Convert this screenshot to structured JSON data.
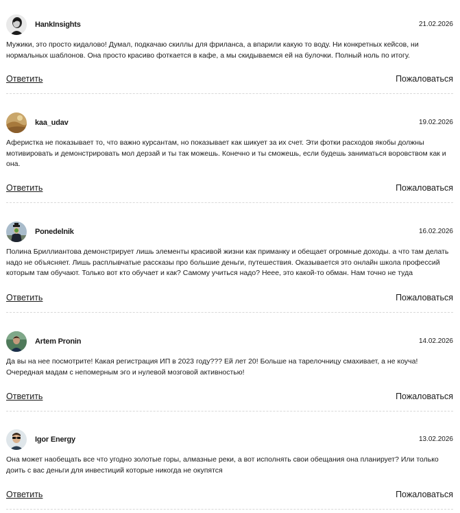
{
  "comments": [
    {
      "author": "HankInsights",
      "date": "21.02.2026",
      "avatar_icon": "man-avatar-icon",
      "text": "Мужики, это просто кидалово! Думал, подкачаю скиллы для фриланса, а впарили какую то воду. Ни конкретных кейсов, ни нормальных шаблонов. Она просто красиво фоткается в кафе, а мы скидываемся ей на булочки. Полный ноль по итогу.",
      "reply_label": "Ответить",
      "report_label": "Пожаловаться"
    },
    {
      "author": "kaa_udav",
      "date": "19.02.2026",
      "avatar_icon": "desert-avatar-icon",
      "text": "Аферистка не показывает то, что важно курсантам, но показывает как шикует за их счет. Эти фотки расходов якобы должны мотивировать и демонстрировать мол дерзай и ты так можешь. Конечно и ты сможешь, если будешь заниматься воровством как и она.",
      "reply_label": "Ответить",
      "report_label": "Пожаловаться"
    },
    {
      "author": "Ponedelnik",
      "date": "16.02.2026",
      "avatar_icon": "apple-man-avatar-icon",
      "text": "Полина Бриллиантова демонстрирует лишь элементы красивой жизни как приманку и обещает огромные доходы. а что там делать надо не объясняет. Лишь расплывчатые рассказы про большие деньги, путешествия. Оказывается это онлайн школа профессий которым там обучают. Только вот кто обучает и как? Самому учиться надо? Нееe, это какой-то обман. Нам точно не туда",
      "reply_label": "Ответить",
      "report_label": "Пожаловаться"
    },
    {
      "author": "Artem Pronin",
      "date": "14.02.2026",
      "avatar_icon": "person-avatar-icon",
      "text": "Да вы на нее посмотрите! Какая регистрация ИП в 2023 году??? Ей лет 20! Больше на тарелочницу смахивает, а не коуча! Очередная мадам с непомерным эго и нулевой мозговой активностью!",
      "reply_label": "Ответить",
      "report_label": "Пожаловаться"
    },
    {
      "author": "Igor Energy",
      "date": "13.02.2026",
      "avatar_icon": "sunglasses-avatar-icon",
      "text": "Она может наобещать все что угодно золотые горы, алмазные реки, а вот исполнять свои обещания она планирует? Или только доить с вас деньги для инвестиций которые никогда не окупятся",
      "reply_label": "Ответить",
      "report_label": "Пожаловаться"
    }
  ]
}
